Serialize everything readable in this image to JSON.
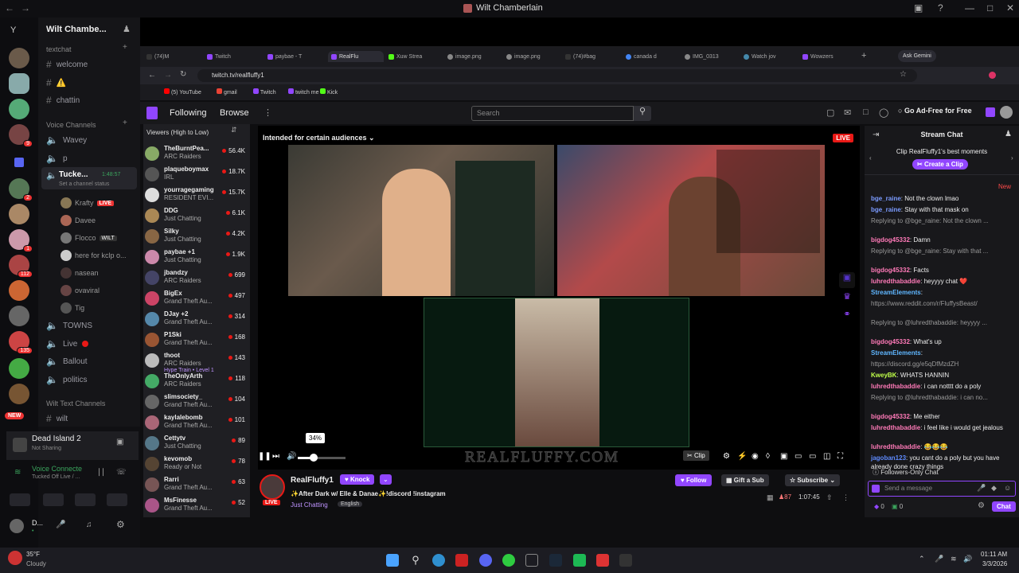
{
  "titlebar": {
    "title": "Wilt Chamberlain"
  },
  "server_badges": [
    "2",
    "1",
    "9",
    "112",
    "135"
  ],
  "server_new": "NEW",
  "server_initial": "Y",
  "discord": {
    "server_name": "Wilt Chambe...",
    "text_category": "textchat",
    "text_channels": [
      "welcome",
      "⚠️",
      "chattin"
    ],
    "voice_category": "Voice Channels",
    "voice_channels": [
      "Wavey",
      "p"
    ],
    "active_voice": {
      "name": "Tucke...",
      "time": "1:48:57",
      "status": "Set a channel status"
    },
    "voice_users": [
      {
        "name": "Krafty",
        "badge": "LIVE"
      },
      {
        "name": "Davee",
        "badge": ""
      },
      {
        "name": "Flocco",
        "badge": "WILT"
      },
      {
        "name": "here for kclp o...",
        "badge": ""
      },
      {
        "name": "nasean",
        "badge": ""
      },
      {
        "name": "ovaviral",
        "badge": ""
      },
      {
        "name": "Tig",
        "badge": ""
      }
    ],
    "more_channels": [
      "TOWNS",
      "Live",
      "Ballout",
      "politics"
    ],
    "wilt_text_category": "Wilt Text Channels",
    "wilt_channel": "wilt",
    "game": {
      "name": "Dead Island 2",
      "status": "Not Sharing"
    },
    "voice_connected": {
      "label": "Voice Connecte",
      "sub": "Tucked Off Live / ..."
    },
    "user": {
      "name": "D...",
      "status": "•"
    }
  },
  "tabs": [
    "(74)M",
    "Twitch",
    "paybae - T",
    "RealFlu",
    "Xuw Strea",
    "image.png",
    "image.png",
    "(74)#bag",
    "canada d",
    "IMG_0313",
    "Watch jov",
    "Wowzers"
  ],
  "ask_gemini": "Ask Gemini",
  "url": "twitch.tv/realfluffy1",
  "bookmarks": [
    "(5) YouTube",
    "gmail",
    "Twitch",
    "twitch me",
    "Kick"
  ],
  "twitch": {
    "nav": [
      "Following",
      "Browse"
    ],
    "search_placeholder": "Search",
    "ad_free": "Go Ad-Free for Free",
    "sort_label": "Viewers (High to Low)",
    "followed": [
      {
        "name": "TheBurntPea...",
        "game": "ARC Raiders",
        "viewers": "56.4K",
        "color": "#8a6"
      },
      {
        "name": "plaqueboymax",
        "game": "IRL",
        "viewers": "18.7K",
        "color": "#555"
      },
      {
        "name": "yourragegaming",
        "game": "RESIDENT EVI...",
        "viewers": "15.7K",
        "color": "#ddd"
      },
      {
        "name": "DDG",
        "game": "Just Chatting",
        "viewers": "6.1K",
        "color": "#a85"
      },
      {
        "name": "Silky",
        "game": "Just Chatting",
        "viewers": "4.2K",
        "color": "#864"
      },
      {
        "name": "paybae +1",
        "game": "Just Chatting",
        "viewers": "1.9K",
        "color": "#c8a"
      },
      {
        "name": "jbandzy",
        "game": "ARC Raiders",
        "viewers": "699",
        "color": "#446"
      },
      {
        "name": "BigEx",
        "game": "Grand Theft Au...",
        "viewers": "497",
        "color": "#c46"
      },
      {
        "name": "DJay +2",
        "game": "Grand Theft Au...",
        "viewers": "314",
        "color": "#58a"
      },
      {
        "name": "P1Ski",
        "game": "Grand Theft Au...",
        "viewers": "168",
        "color": "#953"
      },
      {
        "name": "thoot",
        "game": "ARC Raiders",
        "viewers": "143",
        "color": "#bbb"
      },
      {
        "name": "TheOnlyArth",
        "game": "ARC Raiders",
        "viewers": "118",
        "color": "#4a6"
      },
      {
        "name": "slimsociety_",
        "game": "Grand Theft Au...",
        "viewers": "104",
        "color": "#666"
      },
      {
        "name": "kaylalebomb",
        "game": "Grand Theft Au...",
        "viewers": "101",
        "color": "#a67"
      },
      {
        "name": "Cettytv",
        "game": "Just Chatting",
        "viewers": "89",
        "color": "#578"
      },
      {
        "name": "kevomob",
        "game": "Ready or Not",
        "viewers": "78",
        "color": "#543"
      },
      {
        "name": "Rarri",
        "game": "Grand Theft Au...",
        "viewers": "63",
        "color": "#755"
      },
      {
        "name": "MsFinesse",
        "game": "Grand Theft Au...",
        "viewers": "52",
        "color": "#a58"
      }
    ],
    "hype_train": "Hype Train • Level 1",
    "audience_notice": "Intended for certain audiences",
    "live": "LIVE",
    "volume_tooltip": "34%",
    "volume_level": 0.34,
    "clip": "Clip",
    "watermark": "REALFLUFFY.COM",
    "channel": {
      "name": "RealFluffy1",
      "title": "✨After Dark w/ Elle & Danae✨!discord !instagram",
      "category": "Just Chatting",
      "tag": "English",
      "viewers": "87",
      "uptime": "1:07:45"
    },
    "knock": "Knock",
    "follow": "Follow",
    "gift": "Gift a Sub",
    "subscribe": "Subscribe",
    "chat": {
      "header": "Stream Chat",
      "clip_banner": "Clip RealFluffy1's best moments",
      "create_clip": "Create a Clip",
      "new": "New",
      "messages": [
        {
          "user": "bge_raine",
          "color": "#7b9bff",
          "text": "Not the clown lmao"
        },
        {
          "user": "bge_raine",
          "color": "#7b9bff",
          "text": "Stay with that mask on"
        },
        {
          "user": "",
          "color": "",
          "text": "Replying to @bge_raine: Not the clown ..."
        },
        {
          "user": "bigdog45332",
          "color": "#ff7ab8",
          "text": "Damn"
        },
        {
          "user": "",
          "color": "",
          "text": "Replying to @bge_raine: Stay with that ..."
        },
        {
          "user": "bigdog45332",
          "color": "#ff7ab8",
          "text": "Facts"
        },
        {
          "user": "luhredthabaddie",
          "color": "#ff7ab8",
          "text": "heyyyy chat ❤️"
        },
        {
          "user": "StreamElements",
          "color": "#5fb6ff",
          "text": ""
        },
        {
          "user": "",
          "color": "",
          "text": "https://www.reddit.com/r/FluffysBeast/"
        },
        {
          "user": "",
          "color": "",
          "text": "Replying to @luhredthabaddie: heyyyy ..."
        },
        {
          "user": "bigdog45332",
          "color": "#ff7ab8",
          "text": "What's up"
        },
        {
          "user": "StreamElements",
          "color": "#5fb6ff",
          "text": ""
        },
        {
          "user": "",
          "color": "",
          "text": "https://discord.gg/e5qDfMzdZH"
        },
        {
          "user": "KweyBK",
          "color": "#c0ff4a",
          "text": "WHATS HANNIN"
        },
        {
          "user": "luhredthabaddie",
          "color": "#ff7ab8",
          "text": "i can notttt do a poly"
        },
        {
          "user": "",
          "color": "",
          "text": "Replying to @luhredthabaddie: i can no..."
        },
        {
          "user": "bigdog45332",
          "color": "#ff7ab8",
          "text": "Me either"
        },
        {
          "user": "luhredthabaddie",
          "color": "#ff7ab8",
          "text": "i feel like i would get jealous"
        },
        {
          "user": "luhredthabaddie",
          "color": "#ff7ab8",
          "text": "😂😂😂"
        },
        {
          "user": "jagoban123",
          "color": "#5f8bff",
          "text": "you cant do a poly but you have already done crazy things"
        }
      ],
      "followers_only": "Followers-Only Chat",
      "input_placeholder": "Send a message",
      "points": "0",
      "bits": "0",
      "chat_button": "Chat"
    }
  },
  "taskbar": {
    "temp": "35°F",
    "weather": "Cloudy",
    "time": "01:11 AM",
    "date": "3/3/2026"
  }
}
